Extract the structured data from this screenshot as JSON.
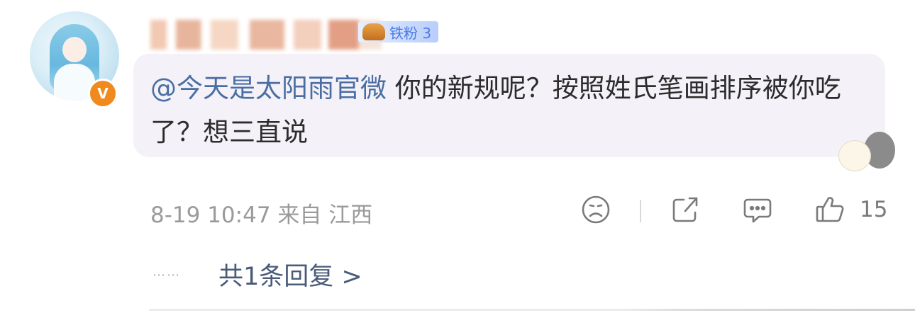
{
  "comment": {
    "author": {
      "name_blurred": true,
      "fan_badge": "铁粉 3",
      "verified_icon": "v-badge-icon"
    },
    "mention": "@今天是太阳雨官微",
    "text": " 你的新规呢？按照姓氏笔画排序被你吃了？想三直说",
    "timestamp": "8-19 10:47",
    "source": "来自 江西",
    "actions": {
      "dislike_icon": "frown-face-icon",
      "share_icon": "share-icon",
      "reply_icon": "comment-bubble-icon",
      "like_icon": "thumbs-up-icon",
      "like_count": "15"
    },
    "reply_summary": {
      "dots": "⋯⋯",
      "label": "共1条回复 >"
    }
  },
  "colors": {
    "mention": "#4a6ea3",
    "bubble_bg": "#f4f2f8",
    "verified": "#f08a1e",
    "fan_badge_text": "#4d7be4"
  }
}
